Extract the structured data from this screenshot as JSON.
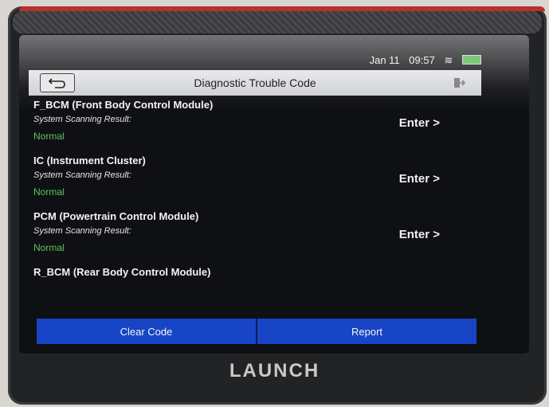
{
  "status": {
    "date": "Jan 11",
    "time": "09:57"
  },
  "header": {
    "title": "Diagnostic Trouble Code"
  },
  "modules": [
    {
      "name": "F_BCM (Front Body Control Module)",
      "subtitle": "System Scanning Result:",
      "status": "Normal",
      "action": "Enter >"
    },
    {
      "name": "IC (Instrument Cluster)",
      "subtitle": "System Scanning Result:",
      "status": "Normal",
      "action": "Enter >"
    },
    {
      "name": "PCM (Powertrain Control Module)",
      "subtitle": "System Scanning Result:",
      "status": "Normal",
      "action": "Enter >"
    },
    {
      "name": "R_BCM (Rear Body Control Module)"
    }
  ],
  "footer": {
    "clear_code": "Clear Code",
    "report": "Report"
  },
  "brand": "LAUNCH",
  "colors": {
    "accent": "#1745c6",
    "status_ok": "#5cc65c"
  }
}
